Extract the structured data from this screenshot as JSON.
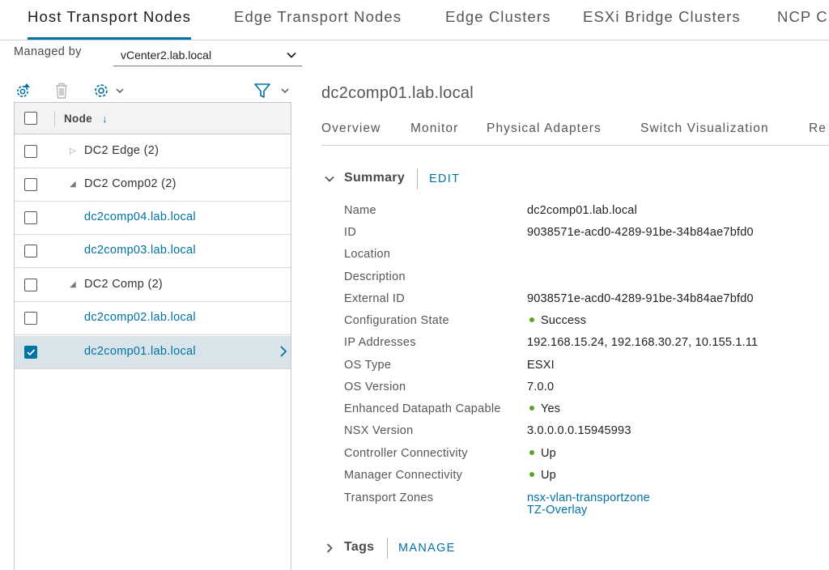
{
  "top_tabs": [
    {
      "label": "Host Transport Nodes",
      "active": true
    },
    {
      "label": "Edge Transport Nodes"
    },
    {
      "label": "Edge Clusters"
    },
    {
      "label": "ESXi Bridge Clusters"
    },
    {
      "label": "NCP C"
    }
  ],
  "managed_by": {
    "label": "Managed by",
    "value": "vCenter2.lab.local"
  },
  "toolbar": {
    "icons": [
      "add-gear-icon",
      "trash-icon",
      "gear-dropdown-icon",
      "filter-icon"
    ]
  },
  "grid": {
    "header": "Node",
    "sort_glyph": "↓",
    "rows": [
      {
        "label": "DC2 Edge (2)",
        "kind": "group",
        "expanded": false,
        "checked": false
      },
      {
        "label": "DC2 Comp02 (2)",
        "kind": "group",
        "expanded": true,
        "checked": false
      },
      {
        "label": "dc2comp04.lab.local",
        "kind": "host",
        "checked": false
      },
      {
        "label": "dc2comp03.lab.local",
        "kind": "host",
        "checked": false
      },
      {
        "label": "DC2 Comp (2)",
        "kind": "group",
        "expanded": true,
        "checked": false
      },
      {
        "label": "dc2comp02.lab.local",
        "kind": "host",
        "checked": false
      },
      {
        "label": "dc2comp01.lab.local",
        "kind": "host",
        "checked": true,
        "selected": true
      }
    ]
  },
  "detail": {
    "title": "dc2comp01.lab.local",
    "tabs": [
      "Overview",
      "Monitor",
      "Physical Adapters",
      "Switch Visualization",
      "Re"
    ],
    "summary": {
      "heading": "Summary",
      "action": "EDIT",
      "properties": [
        {
          "label": "Name",
          "value": "dc2comp01.lab.local"
        },
        {
          "label": "ID",
          "value": "9038571e-acd0-4289-91be-34b84ae7bfd0"
        },
        {
          "label": "Location",
          "value": ""
        },
        {
          "label": "Description",
          "value": ""
        },
        {
          "label": "External ID",
          "value": "9038571e-acd0-4289-91be-34b84ae7bfd0"
        },
        {
          "label": "Configuration State",
          "value": "Success",
          "status": "green"
        },
        {
          "label": "IP Addresses",
          "value": "192.168.15.24, 192.168.30.27, 10.155.1.11"
        },
        {
          "label": "OS Type",
          "value": "ESXI"
        },
        {
          "label": "OS Version",
          "value": "7.0.0"
        },
        {
          "label": "Enhanced Datapath Capable",
          "value": "Yes",
          "status": "green"
        },
        {
          "label": "NSX Version",
          "value": "3.0.0.0.0.15945993"
        },
        {
          "label": "Controller Connectivity",
          "value": "Up",
          "status": "green"
        },
        {
          "label": "Manager Connectivity",
          "value": "Up",
          "status": "green"
        },
        {
          "label": "Transport Zones",
          "links": [
            "nsx-vlan-transportzone",
            "TZ-Overlay"
          ]
        }
      ]
    },
    "tags": {
      "heading": "Tags",
      "action": "MANAGE"
    }
  },
  "colors": {
    "accent": "#0072a3",
    "status_green": "#5aa220",
    "selected_row": "#d9e4ea"
  }
}
